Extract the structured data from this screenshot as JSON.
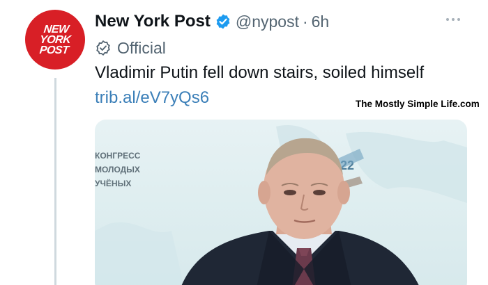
{
  "account": {
    "display_name": "New York Post",
    "handle": "@nypost",
    "separator": "·",
    "time": "6h",
    "label": "Official",
    "avatar_lines": [
      "NEW",
      "YORK",
      "POST"
    ]
  },
  "tweet": {
    "text": "Vladimir Putin fell down stairs, soiled himself",
    "link": "trib.al/eV7yQs6"
  },
  "watermark": "The Mostly Simple Life.com",
  "media": {
    "backdrop_text": [
      "КОНГРЕСС",
      "МОЛОДЫХ",
      "УЧЁНЫХ"
    ],
    "backdrop_number": "22"
  },
  "colors": {
    "brand_red": "#d81f26",
    "verified_blue": "#1d9bf0",
    "link_blue": "#3b7fb8",
    "secondary_text": "#536471"
  },
  "icons": {
    "verified": "verified-badge-icon",
    "official": "official-check-icon",
    "more": "more-icon"
  }
}
